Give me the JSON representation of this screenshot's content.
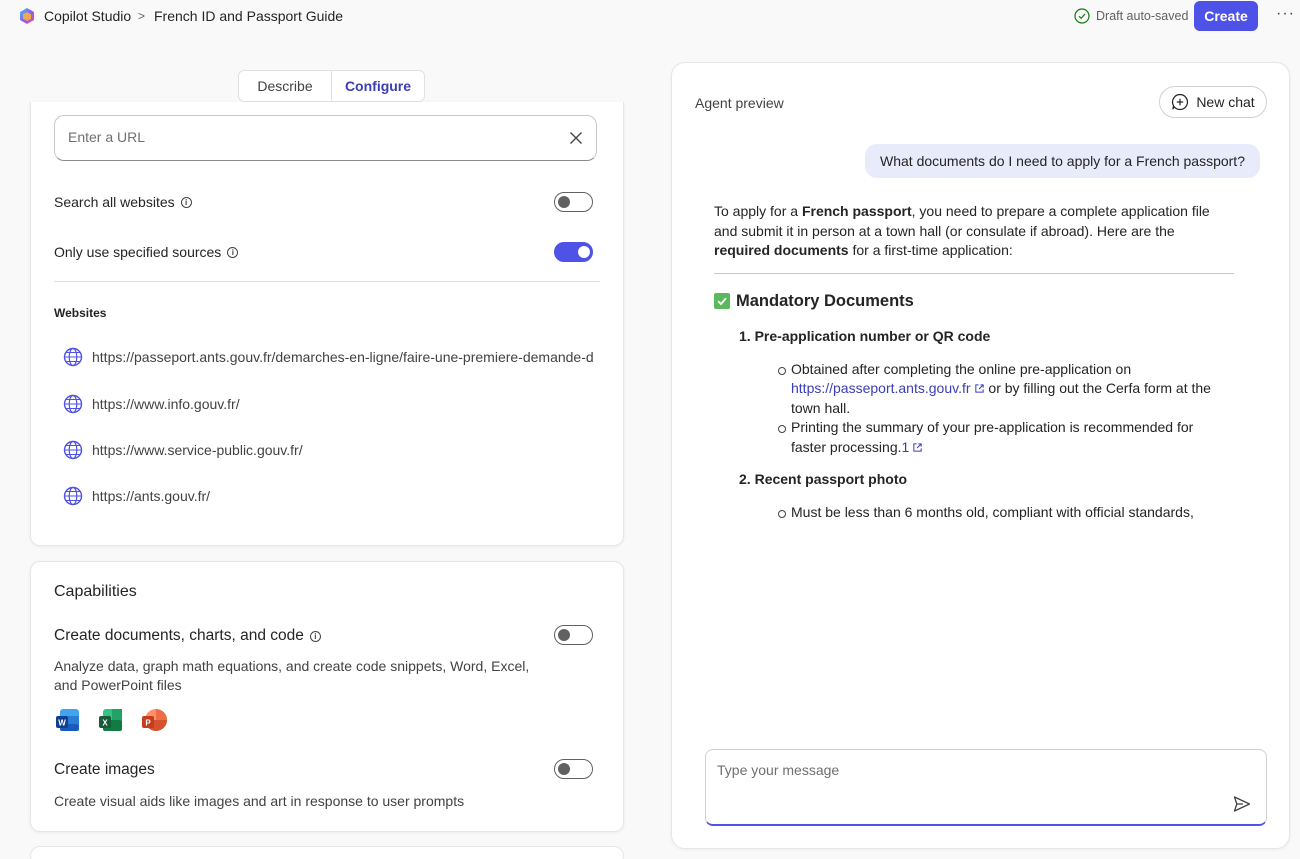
{
  "header": {
    "app_name": "Copilot Studio",
    "breadcrumb_sep": ">",
    "agent_name": "French ID and Passport Guide",
    "save_status": "Draft auto-saved",
    "create_label": "Create",
    "more_label": "···"
  },
  "tabs": {
    "describe": "Describe",
    "configure": "Configure",
    "active": "Configure"
  },
  "knowledge": {
    "url_placeholder": "Enter a URL",
    "search_all_label": "Search all websites",
    "search_all_on": false,
    "only_specified_label": "Only use specified sources",
    "only_specified_on": true,
    "websites_heading": "Websites",
    "websites": [
      "https://passeport.ants.gouv.fr/demarches-en-ligne/faire-une-premiere-demande-de",
      "https://www.info.gouv.fr/",
      "https://www.service-public.gouv.fr/",
      "https://ants.gouv.fr/"
    ]
  },
  "capabilities": {
    "title": "Capabilities",
    "create_docs": {
      "label": "Create documents, charts, and code",
      "enabled": false,
      "description": "Analyze data, graph math equations, and create code snippets, Word, Excel, and PowerPoint files",
      "icons": [
        "word-icon",
        "excel-icon",
        "powerpoint-icon"
      ]
    },
    "create_images": {
      "label": "Create images",
      "enabled": false,
      "description": "Create visual aids like images and art in response to user prompts"
    }
  },
  "preview": {
    "title": "Agent preview",
    "new_chat_label": "New chat",
    "user_message": "What documents do I need to apply for a French passport?",
    "answer": {
      "intro_1": "To apply for a ",
      "intro_bold_1": "French passport",
      "intro_2": ", you need to prepare a complete application file and submit it in person at a town hall (or consulate if abroad). Here are the ",
      "intro_bold_2": "required documents",
      "intro_3": " for a first-time application:",
      "section_title": "Mandatory Documents",
      "item1_num": "1.",
      "item1_title": "Pre-application number or QR code",
      "item1_b1_pre": "Obtained after completing the online pre-application on ",
      "item1_b1_link": "https://passeport.ants.gouv.fr",
      "item1_b1_post": " or by filling out the Cerfa form at the town hall.",
      "item1_b2_text": "Printing the summary of your pre-application is recommended for faster processing.",
      "item1_b2_cite": "1",
      "item2_num": "2.",
      "item2_title": "Recent passport photo",
      "item2_b1": "Must be less than 6 months old, compliant with official standards,"
    },
    "composer_placeholder": "Type your message"
  },
  "colors": {
    "accent": "#4f52e6",
    "link": "#3b3db8",
    "user_bubble": "#e8ebfa",
    "check_green": "#5cb85c"
  }
}
